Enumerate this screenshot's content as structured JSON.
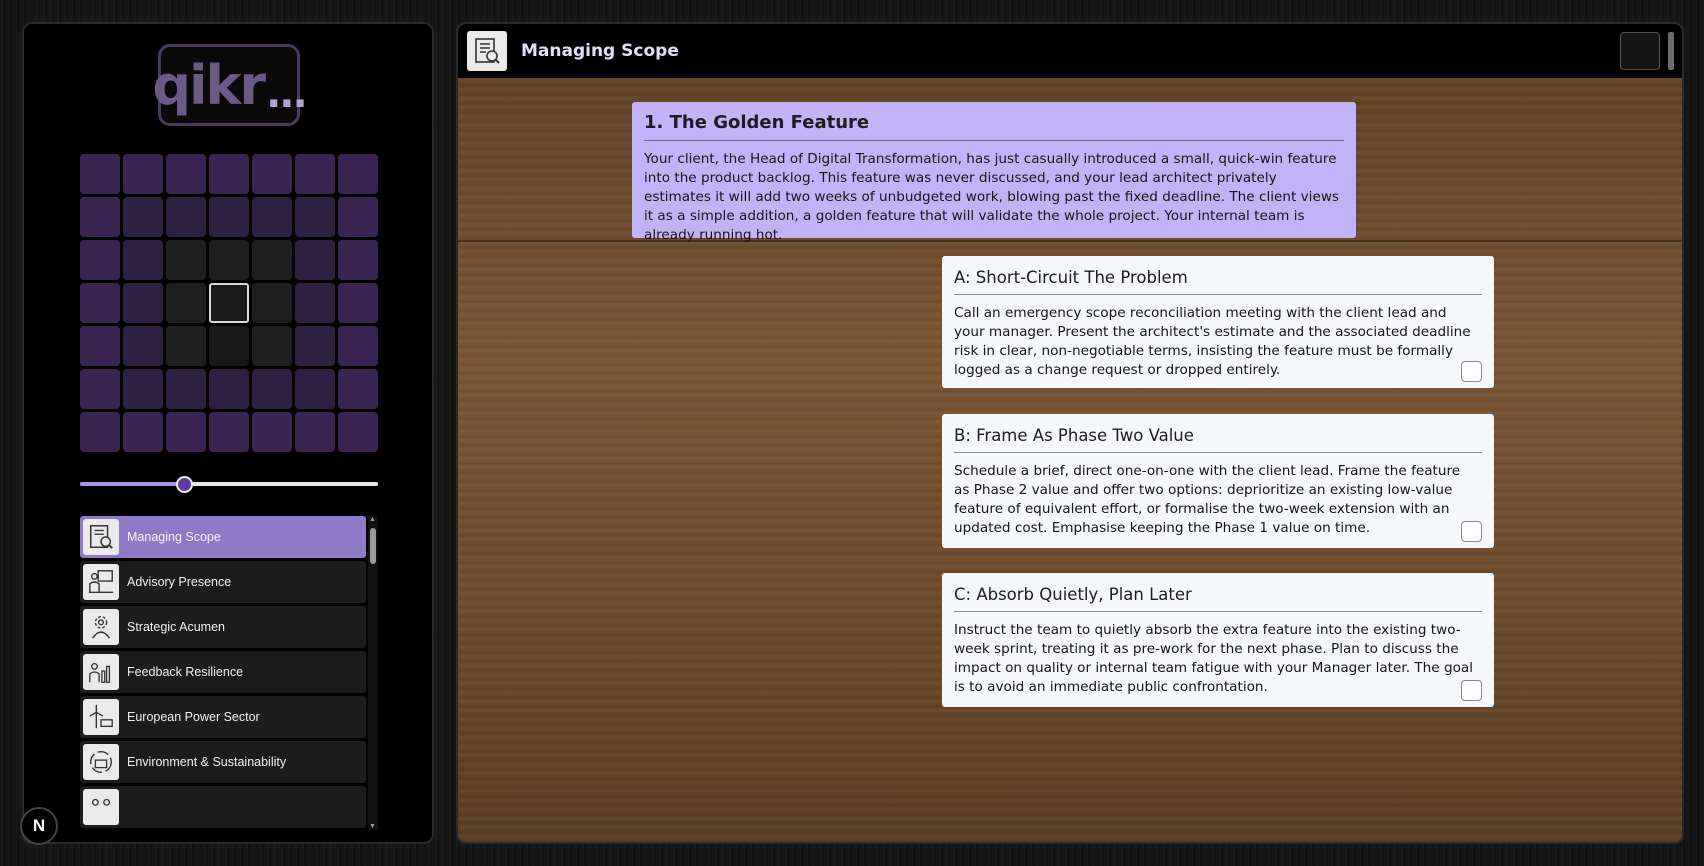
{
  "logo": {
    "text": "qikr",
    "dots": "..."
  },
  "grid": {
    "rows": [
      [
        "l0",
        "l0",
        "l0",
        "l0",
        "l0",
        "l0",
        "l0"
      ],
      [
        "l0",
        "l1",
        "l1",
        "l1",
        "l1",
        "l1",
        "l0"
      ],
      [
        "l0",
        "l1",
        "l2",
        "l2",
        "l2",
        "l1",
        "l0"
      ],
      [
        "l0",
        "l1",
        "l2",
        "sel",
        "l2",
        "l1",
        "l0"
      ],
      [
        "l0",
        "l1",
        "l2",
        "l3",
        "l2",
        "l1",
        "l0"
      ],
      [
        "l0",
        "l1",
        "l1",
        "l1",
        "l1",
        "l1",
        "l0"
      ],
      [
        "l0",
        "l0",
        "l0",
        "l0",
        "l0",
        "l0",
        "l0"
      ]
    ]
  },
  "slider": {
    "value": 0.35
  },
  "sidebar": {
    "items": [
      {
        "label": "Managing Scope",
        "icon": "document-search-icon",
        "active": true
      },
      {
        "label": "Advisory Presence",
        "icon": "presenter-icon",
        "active": false
      },
      {
        "label": "Strategic Acumen",
        "icon": "gear-person-icon",
        "active": false
      },
      {
        "label": "Feedback Resilience",
        "icon": "chart-people-icon",
        "active": false
      },
      {
        "label": "European Power Sector",
        "icon": "wind-solar-icon",
        "active": false
      },
      {
        "label": "Environment & Sustainability",
        "icon": "recycle-factory-icon",
        "active": false
      },
      {
        "label": "",
        "icon": "people-icon",
        "active": false
      }
    ]
  },
  "header": {
    "title": "Managing Scope",
    "icon": "document-search-icon"
  },
  "scenario": {
    "title": "1. The Golden Feature",
    "text": "Your client, the Head of Digital Transformation, has just casually introduced a small, quick-win feature into the product backlog. This feature was never discussed, and your lead architect privately estimates it will add two weeks of unbudgeted work, blowing past the fixed deadline. The client views it as a simple addition, a golden feature that will validate the whole project. Your internal team is already running hot."
  },
  "options": [
    {
      "title": "A: Short-Circuit The Problem",
      "text": "Call an emergency scope reconciliation meeting with the client lead and your manager. Present the architect's estimate and the associated deadline risk in clear, non-negotiable terms, insisting the feature must be formally logged as a change request or dropped entirely."
    },
    {
      "title": "B: Frame As Phase Two Value",
      "text": "Schedule a brief, direct one-on-one with the client lead. Frame the feature as Phase 2 value and offer two options: deprioritize an existing low-value feature of equivalent effort, or formalise the two-week extension with an updated cost. Emphasise keeping the Phase 1 value on time."
    },
    {
      "title": "C: Absorb Quietly, Plan Later",
      "text": "Instruct the team to quietly absorb the extra feature into the existing two-week sprint, treating it as pre-work for the next phase. Plan to discuss the impact on quality or internal team fatigue with your Manager later. The goal is to avoid an immediate public confrontation."
    }
  ],
  "footer_badge": "N"
}
